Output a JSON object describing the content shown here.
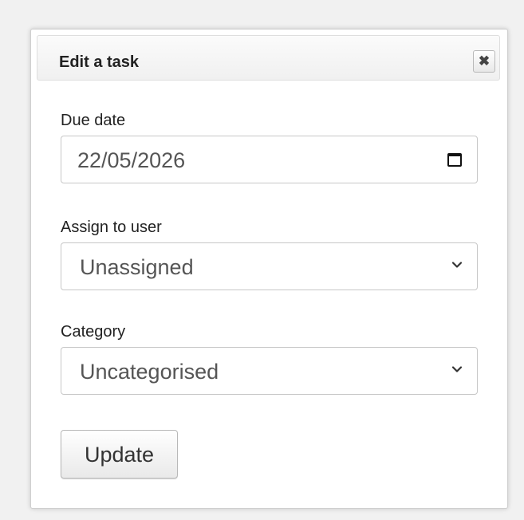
{
  "dialog": {
    "title": "Edit a task",
    "close_icon": "close-icon"
  },
  "form": {
    "due_date": {
      "label": "Due date",
      "value": "22/05/2026",
      "icon": "calendar-icon"
    },
    "assign_to_user": {
      "label": "Assign to user",
      "value": "Unassigned",
      "icon": "chevron-down-icon"
    },
    "category": {
      "label": "Category",
      "value": "Uncategorised",
      "icon": "chevron-down-icon"
    },
    "update_label": "Update"
  }
}
